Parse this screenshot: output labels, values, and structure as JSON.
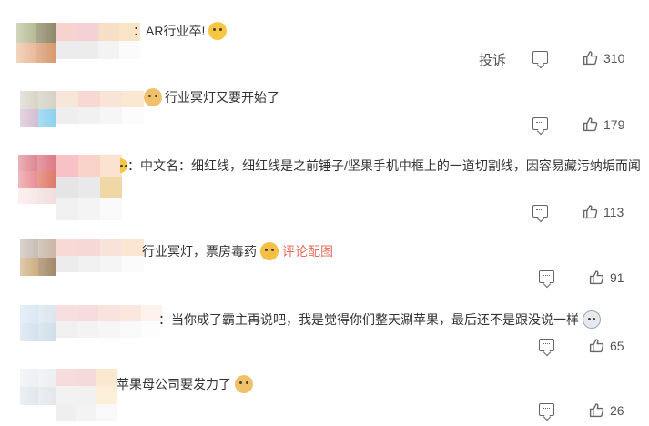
{
  "comments": [
    {
      "text": "AR行业卒!",
      "prefix": "：",
      "emoji": "crying-icon",
      "link": "",
      "report": "投诉",
      "likes": "310"
    },
    {
      "text": "行业冥灯又要开始了",
      "prefix": "",
      "emoji": "doge-icon",
      "emoji_first": true,
      "link": "",
      "report": "",
      "likes": "179"
    },
    {
      "text": "中文名：细红线，细红线是之前锤子/坚果手机中框上的一道切割线，因容易藏污纳垢而闻",
      "prefix": "：",
      "emoji": "",
      "link": "",
      "report": "",
      "likes": "113"
    },
    {
      "text": "行业冥灯，票房毒药",
      "prefix": "",
      "emoji": "laugh-cry-icon",
      "link": "评论配图",
      "report": "",
      "likes": "91"
    },
    {
      "text": "当你成了霸主再说吧，我是觉得你们整天涮苹果，最后还不是跟没说一样",
      "prefix": "：",
      "emoji": "grimace-icon",
      "link": "",
      "report": "",
      "likes": "65"
    },
    {
      "text": "苹果母公司要发力了",
      "prefix": "",
      "emoji": "doge-icon",
      "link": "",
      "report": "",
      "likes": "26"
    }
  ],
  "colors": {
    "link": "#e66c5b",
    "text": "#333333",
    "meta": "#555555"
  }
}
